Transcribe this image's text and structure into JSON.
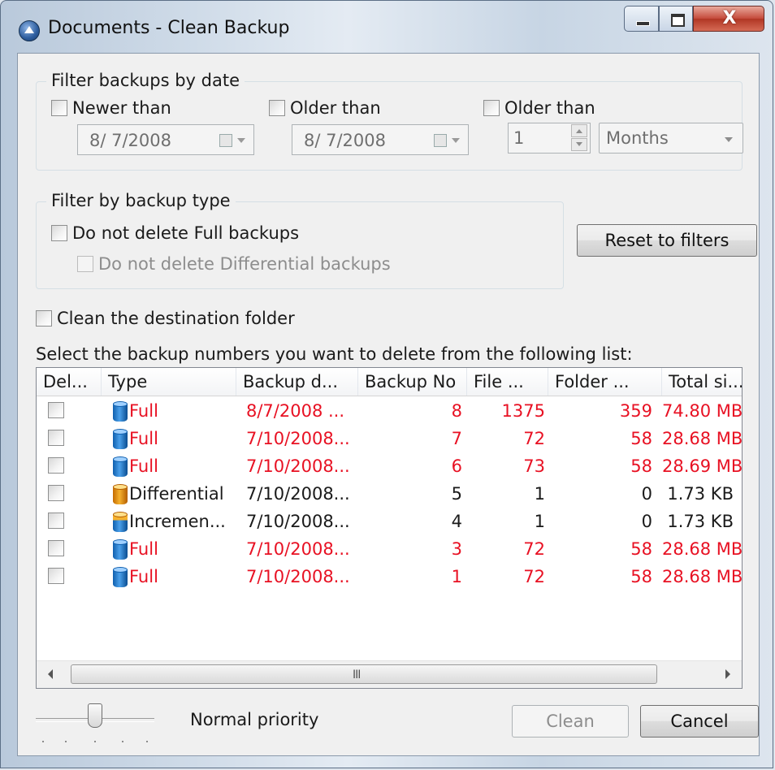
{
  "window": {
    "title": "Documents - Clean Backup",
    "close_glyph": "X"
  },
  "filter_date": {
    "legend": "Filter backups by date",
    "newer_than": {
      "label": "Newer than",
      "date": "8/ 7/2008"
    },
    "older_than_date": {
      "label": "Older than",
      "date": "8/ 7/2008"
    },
    "older_than_period": {
      "label": "Older than",
      "value": "1",
      "unit": "Months"
    }
  },
  "filter_type": {
    "legend": "Filter by backup type",
    "no_full": "Do not delete Full backups",
    "no_diff": "Do not delete Differential backups"
  },
  "reset_button": "Reset to filters",
  "clean_destination": "Clean the destination folder",
  "list_caption": "Select the backup numbers you want to delete from the following list:",
  "columns": [
    "Del...",
    "Type",
    "Backup d...",
    "Backup No",
    "File ...",
    "Folder ...",
    "Total si..."
  ],
  "rows": [
    {
      "type": "Full",
      "date": "8/7/2008 ...",
      "no": "8",
      "files": "1375",
      "folders": "359",
      "size": "74.80 MB",
      "highlight": true,
      "icon": "full-backup-icon"
    },
    {
      "type": "Full",
      "date": "7/10/2008...",
      "no": "7",
      "files": "72",
      "folders": "58",
      "size": "28.68 MB",
      "highlight": true,
      "icon": "full-backup-icon"
    },
    {
      "type": "Full",
      "date": "7/10/2008...",
      "no": "6",
      "files": "73",
      "folders": "58",
      "size": "28.69 MB",
      "highlight": true,
      "icon": "full-backup-icon"
    },
    {
      "type": "Differential",
      "date": "7/10/2008...",
      "no": "5",
      "files": "1",
      "folders": "0",
      "size": "1.73 KB",
      "highlight": false,
      "icon": "differential-backup-icon"
    },
    {
      "type": "Incremen...",
      "date": "7/10/2008...",
      "no": "4",
      "files": "1",
      "folders": "0",
      "size": "1.73 KB",
      "highlight": false,
      "icon": "incremental-backup-icon"
    },
    {
      "type": "Full",
      "date": "7/10/2008...",
      "no": "3",
      "files": "72",
      "folders": "58",
      "size": "28.68 MB",
      "highlight": true,
      "icon": "full-backup-icon"
    },
    {
      "type": "Full",
      "date": "7/10/2008...",
      "no": "1",
      "files": "72",
      "folders": "58",
      "size": "28.68 MB",
      "highlight": true,
      "icon": "full-backup-icon"
    }
  ],
  "scrollbar_grip": "III",
  "priority_label": "Normal priority",
  "clean_button": "Clean",
  "cancel_button": "Cancel",
  "colors": {
    "highlight_text": "#e81123"
  }
}
